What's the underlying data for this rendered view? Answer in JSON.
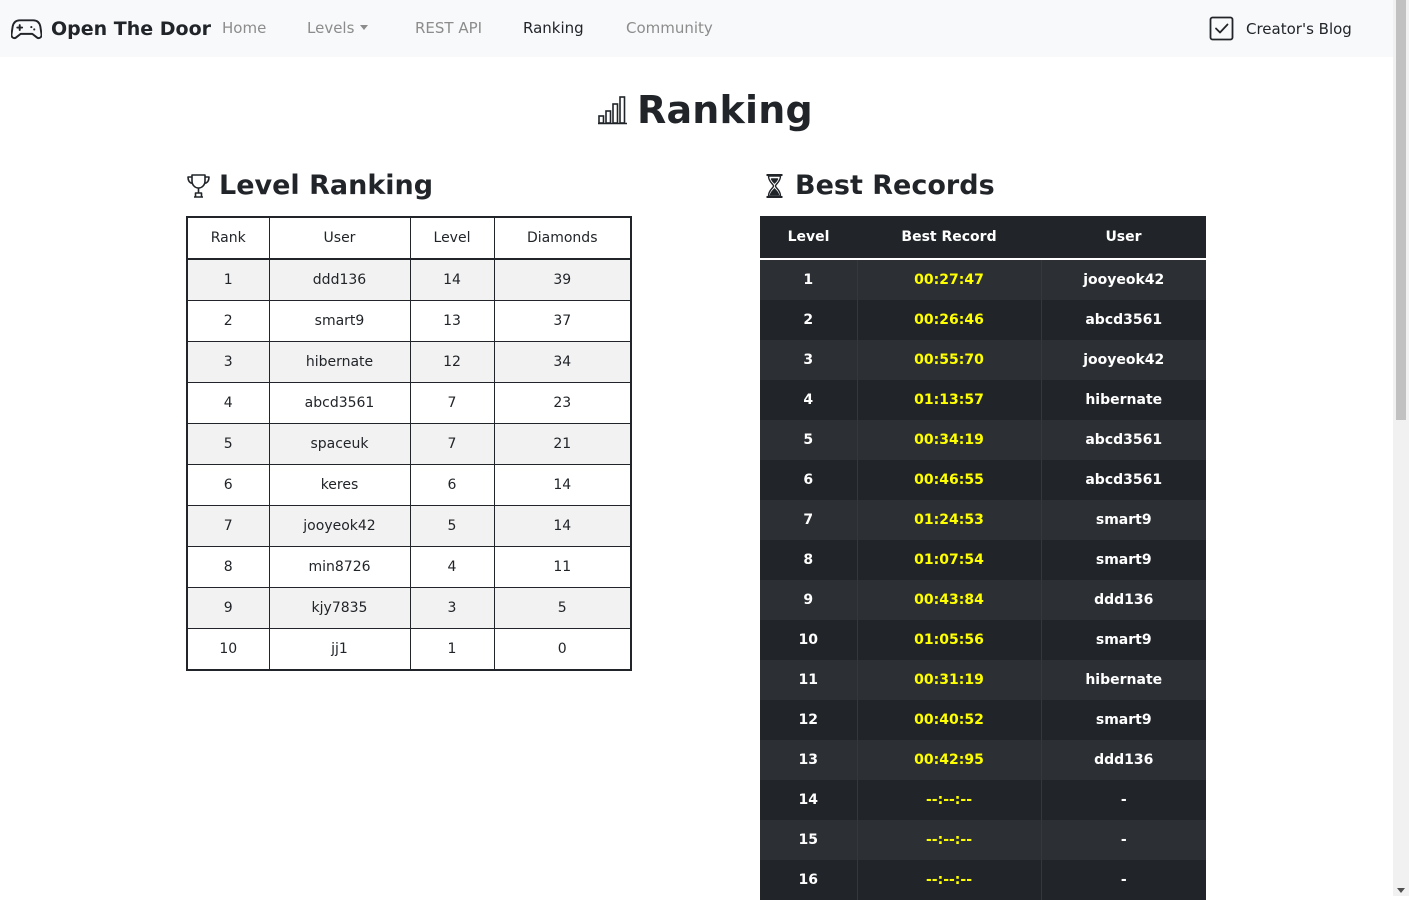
{
  "navbar": {
    "brand": "Open The Door",
    "items": [
      {
        "label": "Home",
        "active": false
      },
      {
        "label": "Levels",
        "active": false,
        "dropdown": true
      },
      {
        "label": "REST API",
        "active": false
      },
      {
        "label": "Ranking",
        "active": true
      },
      {
        "label": "Community",
        "active": false
      }
    ],
    "blog_label": "Creator's Blog"
  },
  "page_title": "Ranking",
  "level_ranking": {
    "title": "Level Ranking",
    "headers": [
      "Rank",
      "User",
      "Level",
      "Diamonds"
    ],
    "rows": [
      [
        "1",
        "ddd136",
        "14",
        "39"
      ],
      [
        "2",
        "smart9",
        "13",
        "37"
      ],
      [
        "3",
        "hibernate",
        "12",
        "34"
      ],
      [
        "4",
        "abcd3561",
        "7",
        "23"
      ],
      [
        "5",
        "spaceuk",
        "7",
        "21"
      ],
      [
        "6",
        "keres",
        "6",
        "14"
      ],
      [
        "7",
        "jooyeok42",
        "5",
        "14"
      ],
      [
        "8",
        "min8726",
        "4",
        "11"
      ],
      [
        "9",
        "kjy7835",
        "3",
        "5"
      ],
      [
        "10",
        "jj1",
        "1",
        "0"
      ]
    ]
  },
  "best_records": {
    "title": "Best Records",
    "headers": [
      "Level",
      "Best Record",
      "User"
    ],
    "rows": [
      [
        "1",
        "00:27:47",
        "jooyeok42"
      ],
      [
        "2",
        "00:26:46",
        "abcd3561"
      ],
      [
        "3",
        "00:55:70",
        "jooyeok42"
      ],
      [
        "4",
        "01:13:57",
        "hibernate"
      ],
      [
        "5",
        "00:34:19",
        "abcd3561"
      ],
      [
        "6",
        "00:46:55",
        "abcd3561"
      ],
      [
        "7",
        "01:24:53",
        "smart9"
      ],
      [
        "8",
        "01:07:54",
        "smart9"
      ],
      [
        "9",
        "00:43:84",
        "ddd136"
      ],
      [
        "10",
        "01:05:56",
        "smart9"
      ],
      [
        "11",
        "00:31:19",
        "hibernate"
      ],
      [
        "12",
        "00:40:52",
        "smart9"
      ],
      [
        "13",
        "00:42:95",
        "ddd136"
      ],
      [
        "14",
        "--:--:--",
        "-"
      ],
      [
        "15",
        "--:--:--",
        "-"
      ],
      [
        "16",
        "--:--:--",
        "-"
      ]
    ]
  },
  "colors": {
    "navbar_bg": "#f8f9fa",
    "dark_table_bg": "#212529",
    "record_time": "#ffff00"
  },
  "icons": {
    "brand": "gamepad-icon",
    "blog": "check-square-icon",
    "page_title": "bar-chart-icon",
    "level_ranking": "trophy-icon",
    "best_records": "hourglass-icon"
  }
}
